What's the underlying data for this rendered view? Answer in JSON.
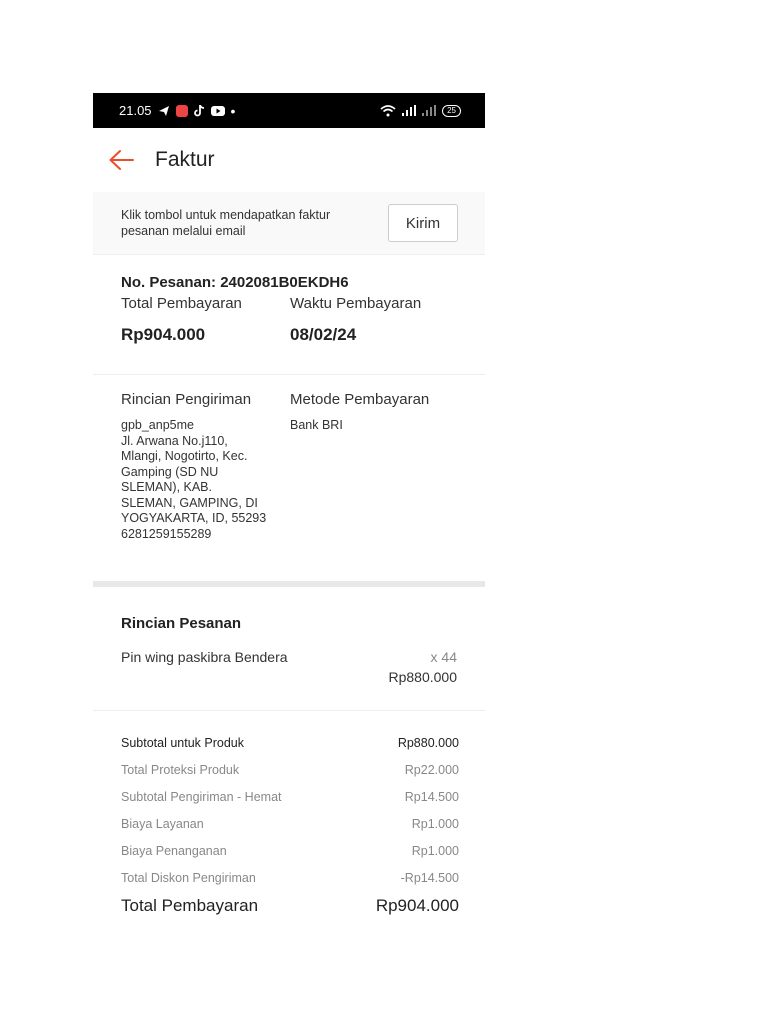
{
  "status_bar": {
    "time": "21.05",
    "battery": "25"
  },
  "header": {
    "title": "Faktur"
  },
  "notice": {
    "text": "Klik tombol untuk mendapatkan faktur pesanan melalui email",
    "button": "Kirim"
  },
  "order": {
    "number": "No. Pesanan: 2402081B0EKDH6",
    "total_label": "Total Pembayaran",
    "total_value": "Rp904.000",
    "time_label": "Waktu Pembayaran",
    "time_value": "08/02/24"
  },
  "shipping": {
    "label": "Rincian Pengiriman",
    "address": "gpb_anp5me\nJl. Arwana No.j110,\nMlangi, Nogotirto, Kec.\nGamping (SD NU\nSLEMAN), KAB.\nSLEMAN, GAMPING, DI\nYOGYAKARTA, ID, 55293\n6281259155289",
    "payment_label": "Metode Pembayaran",
    "payment_value": "Bank BRI"
  },
  "order_detail": {
    "title": "Rincian Pesanan",
    "item_name": "Pin wing paskibra Bendera",
    "item_qty": "x 44",
    "item_price": "Rp880.000"
  },
  "summary": {
    "rows": [
      {
        "label": "Subtotal untuk Produk",
        "value": "Rp880.000"
      },
      {
        "label": "Total Proteksi Produk",
        "value": "Rp22.000"
      },
      {
        "label": "Subtotal Pengiriman - Hemat",
        "value": "Rp14.500"
      },
      {
        "label": "Biaya Layanan",
        "value": "Rp1.000"
      },
      {
        "label": "Biaya Penanganan",
        "value": "Rp1.000"
      },
      {
        "label": "Total Diskon Pengiriman",
        "value": "-Rp14.500"
      }
    ],
    "total_label": "Total Pembayaran",
    "total_value": "Rp904.000"
  },
  "colors": {
    "accent": "#ee4d2d"
  }
}
